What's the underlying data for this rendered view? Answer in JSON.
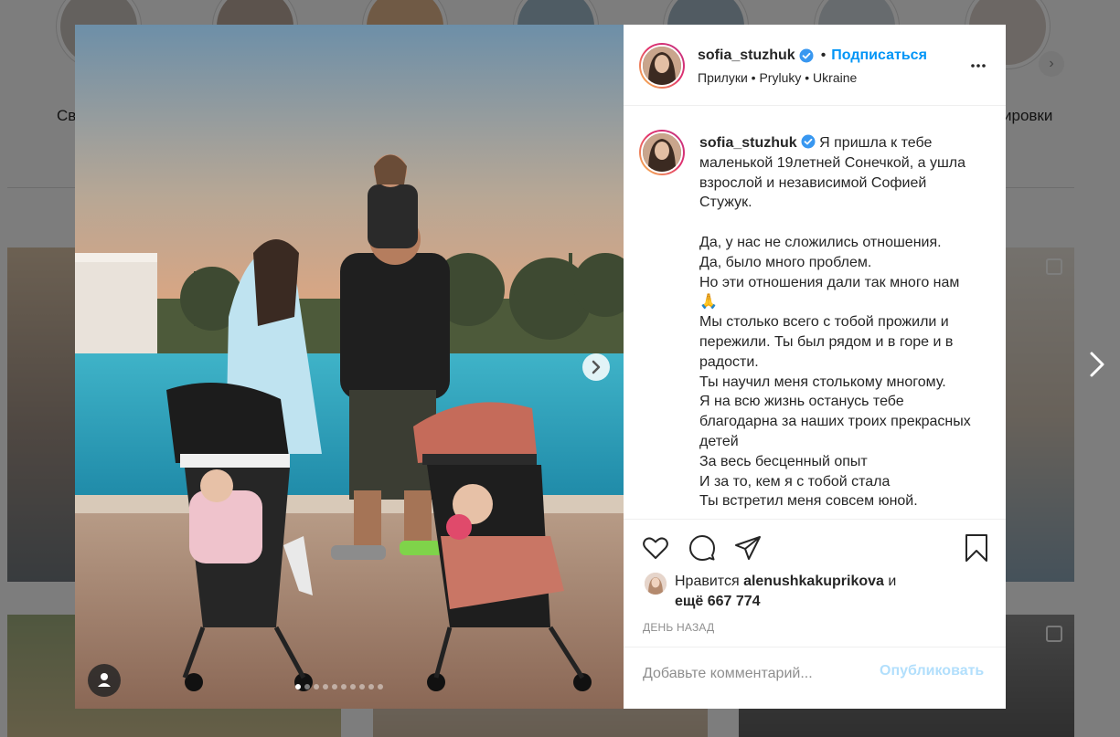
{
  "background": {
    "highlight_labels": [
      "Св",
      "ировки"
    ]
  },
  "post": {
    "username": "sofia_stuzhuk",
    "follow_label": "Подписаться",
    "separator": "•",
    "location": "Прилуки • Pryluky • Ukraine",
    "caption_lines": [
      "Я пришла к тебе маленькой 19летней Сонечкой, а ушла взрослой и независимой Софией Стужук.",
      "",
      "Да, у нас не сложились отношения.",
      "Да, было много проблем.",
      "Но эти отношения дали так много нам🙏",
      "Мы столько всего с тобой прожили и пережили. Ты был рядом и в горе и в радости.",
      "Ты научил меня столькому многому.",
      "Я на всю жизнь останусь тебе благодарна за наших троих прекрасных детей",
      "За весь бесценный опыт",
      "И за то, кем я с тобой стала",
      "Ты встретил меня совсем юной."
    ],
    "caption": "Я пришла к тебе маленькой 19летней Сонечкой, а ушла взрослой и независимой Софией Стужук.\n\nДа, у нас не сложились отношения.\nДа, было много проблем.\nНо эти отношения дали так много нам🙏\nМы столько всего с тобой прожили и пережили. Ты был рядом и в горе и в радости.\nТы научил меня столькому многому.\nЯ на всю жизнь останусь тебе благодарна за наших троих прекрасных детей\nЗа весь бесценный опыт\nИ за то, кем я с тобой стала\nТы встретил меня совсем юной.",
    "likes": {
      "prefix": "Нравится",
      "liker": "alenushkakuprikova",
      "conjunction": "и",
      "others": "ещё 667 774"
    },
    "timestamp": "ДЕНЬ НАЗАД",
    "comment_placeholder": "Добавьте комментарий...",
    "publish_label": "Опубликовать",
    "carousel_total": 10,
    "carousel_active": 1
  },
  "icons": {
    "verified": "verified-badge-icon",
    "more": "more-options-icon",
    "like": "heart-icon",
    "comment": "comment-icon",
    "share": "send-icon",
    "save": "bookmark-icon",
    "next": "chevron-right-icon",
    "user_tags": "user-tag-icon"
  },
  "colors": {
    "link_blue": "#0095f6",
    "publish_disabled": "#b2dffc",
    "verified_blue": "#3897f0",
    "text": "#262626",
    "muted": "#8e8e8e"
  }
}
